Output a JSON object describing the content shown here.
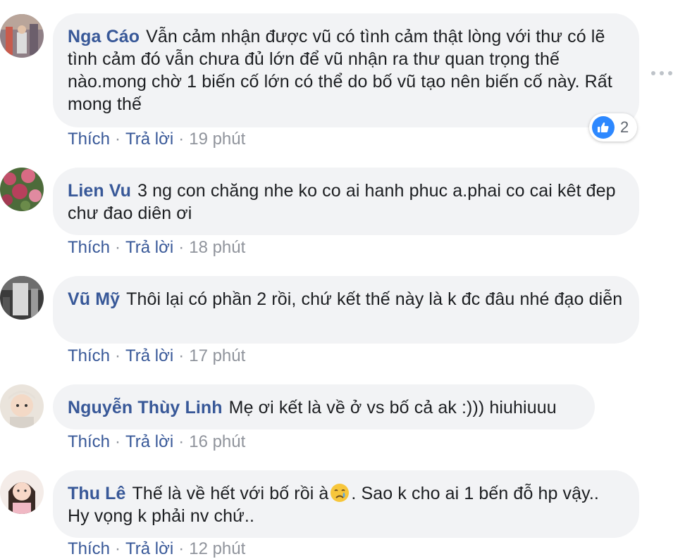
{
  "comments": [
    {
      "author": "Nga Cáo",
      "text": "Vẫn cảm nhận được vũ có tình cảm thật lòng với thư có lẽ tình cảm đó vẫn chưa đủ lớn để vũ nhận ra thư quan trọng thế nào.mong chờ 1 biến cố lớn có thể do bố vũ tạo nên biến cố này. Rất mong thế",
      "like": "Thích",
      "reply": "Trả lời",
      "time": "19 phút",
      "reaction_count": "2"
    },
    {
      "author": "Lien Vu",
      "text": "3 ng con chăng nhe ko co ai hanh phuc a.phai co cai kêt đep chư đao diên ơi",
      "like": "Thích",
      "reply": "Trả lời",
      "time": "18 phút"
    },
    {
      "author": "Vũ Mỹ",
      "text": "Thôi lại có phần 2 rồi, chứ kết thế này là k đc đâu nhé đạo diễn",
      "like": "Thích",
      "reply": "Trả lời",
      "time": "17 phút"
    },
    {
      "author": "Nguyễn Thùy Linh",
      "text": "Mẹ ơi kết là về ở vs bố cả ak :))) hiuhiuuu",
      "like": "Thích",
      "reply": "Trả lời",
      "time": "16 phút"
    },
    {
      "author": "Thu Lê",
      "text_before_emoji": "Thế là về hết với bố rồi à",
      "emoji": "crying-face-emoji",
      "text_after_emoji": ". Sao k cho ai 1 bến đỗ hp vậy.. Hy vọng k phải nv chứ..",
      "like": "Thích",
      "reply": "Trả lời",
      "time": "12 phút"
    }
  ],
  "separator": "·",
  "colors": {
    "author": "#385898",
    "bubble": "#f2f3f5",
    "meta": "#90949c",
    "like_blue": "#2d88ff"
  }
}
